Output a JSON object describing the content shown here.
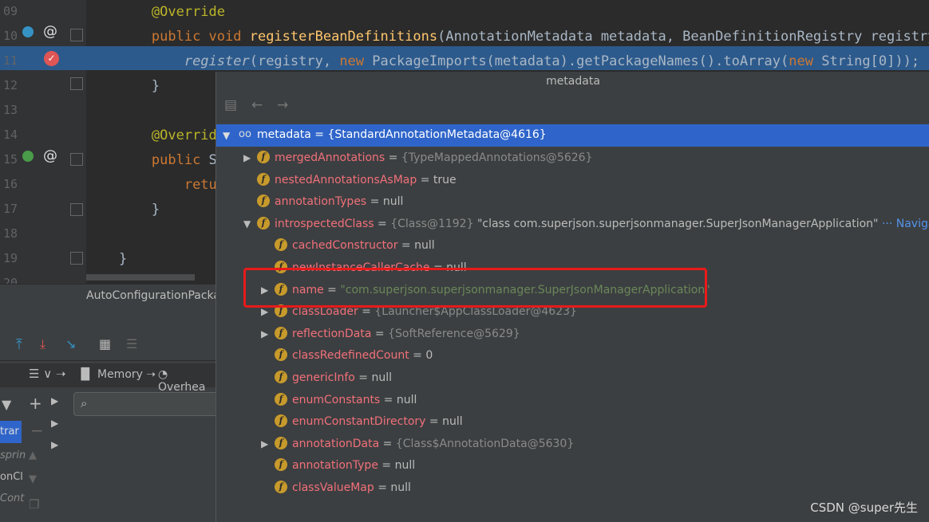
{
  "editor": {
    "line_numbers": [
      "09",
      "10",
      "11",
      "12",
      "13",
      "14",
      "15",
      "16",
      "17",
      "18",
      "19",
      "20"
    ],
    "lines": [
      {
        "parts": [
          {
            "t": "        ",
            "c": "pa"
          },
          {
            "t": "@Override",
            "c": "an"
          }
        ]
      },
      {
        "parts": [
          {
            "t": "        ",
            "c": "pa"
          },
          {
            "t": "public void ",
            "c": "kw"
          },
          {
            "t": "registerBeanDefinitions",
            "c": "fn"
          },
          {
            "t": "(AnnotationMetadata metadata, BeanDefinitionRegistry registry) {",
            "c": "pa"
          }
        ]
      },
      {
        "parts": [
          {
            "t": "            ",
            "c": "pa"
          },
          {
            "t": "register",
            "c": "pa it"
          },
          {
            "t": "(registry, ",
            "c": "pa"
          },
          {
            "t": "new ",
            "c": "kw"
          },
          {
            "t": "PackageImports(metadata).getPackageNames().toArray(",
            "c": "pa"
          },
          {
            "t": "new ",
            "c": "kw"
          },
          {
            "t": "String[",
            "c": "pa"
          },
          {
            "t": "0",
            "c": "pa"
          },
          {
            "t": "]));  ",
            "c": "pa"
          },
          {
            "t": "re",
            "c": "gray it"
          }
        ]
      },
      {
        "parts": [
          {
            "t": "        }",
            "c": "pa"
          }
        ]
      },
      {
        "parts": [
          {
            "t": "",
            "c": "pa"
          }
        ]
      },
      {
        "parts": [
          {
            "t": "        ",
            "c": "pa"
          },
          {
            "t": "@Override",
            "c": "an"
          }
        ]
      },
      {
        "parts": [
          {
            "t": "        ",
            "c": "pa"
          },
          {
            "t": "public ",
            "c": "kw"
          },
          {
            "t": "Se",
            "c": "pa"
          }
        ]
      },
      {
        "parts": [
          {
            "t": "            ",
            "c": "pa"
          },
          {
            "t": "retu",
            "c": "kw"
          }
        ]
      },
      {
        "parts": [
          {
            "t": "        }",
            "c": "pa"
          }
        ]
      },
      {
        "parts": [
          {
            "t": "",
            "c": "pa"
          }
        ]
      },
      {
        "parts": [
          {
            "t": "    }",
            "c": "pa"
          }
        ]
      }
    ],
    "breadcrumb": "AutoConfigurationPackag"
  },
  "debugger": {
    "tabs": [
      "Memory",
      "Overhea"
    ],
    "side_labels": [
      "trar",
      "sprin",
      "onCl",
      "Cont"
    ]
  },
  "popup": {
    "title": "metadata",
    "root": {
      "name": "metadata",
      "value": "{StandardAnnotationMetadata@4616}"
    },
    "rows": [
      {
        "expand": "closed",
        "indent": 0,
        "name": "mergedAnnotations",
        "value": "{TypeMappedAnnotations@5626}",
        "vtype": "gray"
      },
      {
        "expand": "none",
        "indent": 0,
        "name": "nestedAnnotationsAsMap",
        "value": "true",
        "vtype": "val"
      },
      {
        "expand": "none",
        "indent": 0,
        "name": "annotationTypes",
        "value": "null",
        "vtype": "val"
      },
      {
        "expand": "open",
        "indent": 0,
        "name": "introspectedClass",
        "value": "{Class@1192}",
        "vtype": "gray",
        "extra": "\"class com.superjson.superjsonmanager.SuperJsonManagerApplication\"",
        "nav": "··· Navigate"
      },
      {
        "expand": "none",
        "indent": 1,
        "name": "cachedConstructor",
        "value": "null",
        "vtype": "val"
      },
      {
        "expand": "none",
        "indent": 1,
        "name": "newInstanceCallerCache",
        "value": "null",
        "vtype": "val"
      },
      {
        "expand": "closed",
        "indent": 1,
        "name": "name",
        "value": "\"com.superjson.superjsonmanager.SuperJsonManagerApplication\"",
        "vtype": "str"
      },
      {
        "expand": "closed",
        "indent": 1,
        "name": "classLoader",
        "value": "{Launcher$AppClassLoader@4623}",
        "vtype": "gray"
      },
      {
        "expand": "closed",
        "indent": 1,
        "name": "reflectionData",
        "value": "{SoftReference@5629}",
        "vtype": "gray"
      },
      {
        "expand": "none",
        "indent": 1,
        "name": "classRedefinedCount",
        "value": "0",
        "vtype": "val"
      },
      {
        "expand": "none",
        "indent": 1,
        "name": "genericInfo",
        "value": "null",
        "vtype": "val"
      },
      {
        "expand": "none",
        "indent": 1,
        "name": "enumConstants",
        "value": "null",
        "vtype": "val"
      },
      {
        "expand": "none",
        "indent": 1,
        "name": "enumConstantDirectory",
        "value": "null",
        "vtype": "val"
      },
      {
        "expand": "closed",
        "indent": 1,
        "name": "annotationData",
        "value": "{Class$AnnotationData@5630}",
        "vtype": "gray"
      },
      {
        "expand": "none",
        "indent": 1,
        "name": "annotationType",
        "value": "null",
        "vtype": "val"
      },
      {
        "expand": "none",
        "indent": 1,
        "name": "classValueMap",
        "value": "null",
        "vtype": "val"
      }
    ]
  },
  "watermark": "CSDN @super先生",
  "colors": {
    "accent": "#2f65ca",
    "highlight_box": "#e81a1a"
  }
}
